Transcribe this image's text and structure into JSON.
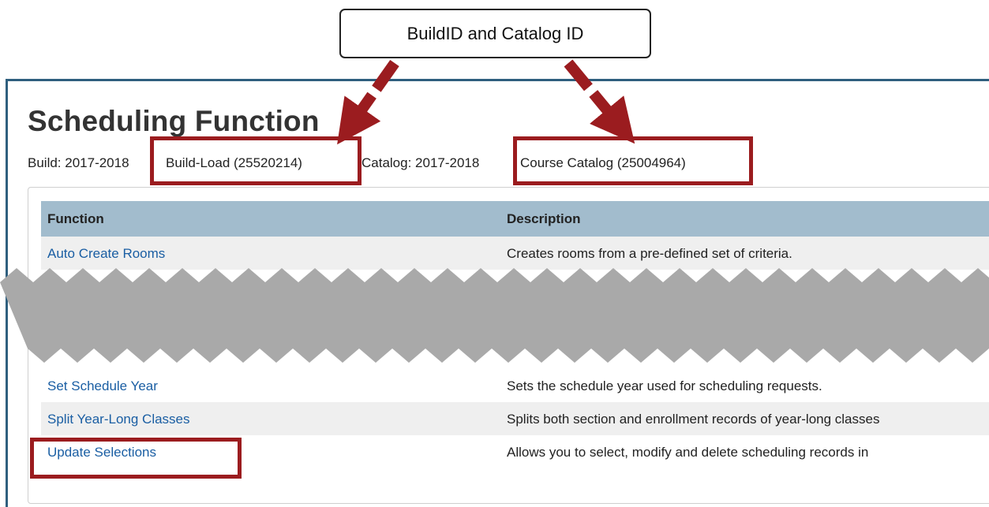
{
  "callout": {
    "text": "BuildID and Catalog ID"
  },
  "page": {
    "title": "Scheduling Function",
    "build_label": "Build: 2017-2018",
    "build_value": "Build-Load (25520214)",
    "catalog_label": "Catalog: 2017-2018",
    "catalog_value": "Course Catalog (25004964)"
  },
  "table": {
    "headers": [
      "Function",
      "Description"
    ],
    "rows": [
      {
        "function": "Auto Create Rooms",
        "description": "Creates rooms from a pre-defined set of criteria."
      },
      {
        "function": "Set Schedule Year",
        "description": "Sets the schedule year used for scheduling requests."
      },
      {
        "function": "Split Year-Long Classes",
        "description": "Splits both section and enrollment records of year-long classes"
      },
      {
        "function": "Update Selections",
        "description": "Allows you to select, modify and delete scheduling records in"
      }
    ]
  },
  "annotation_colors": {
    "highlight": "#9b1c1f",
    "redaction": "#a9a9a9",
    "header_bg": "#a2bccd",
    "link": "#1a5ea3"
  }
}
